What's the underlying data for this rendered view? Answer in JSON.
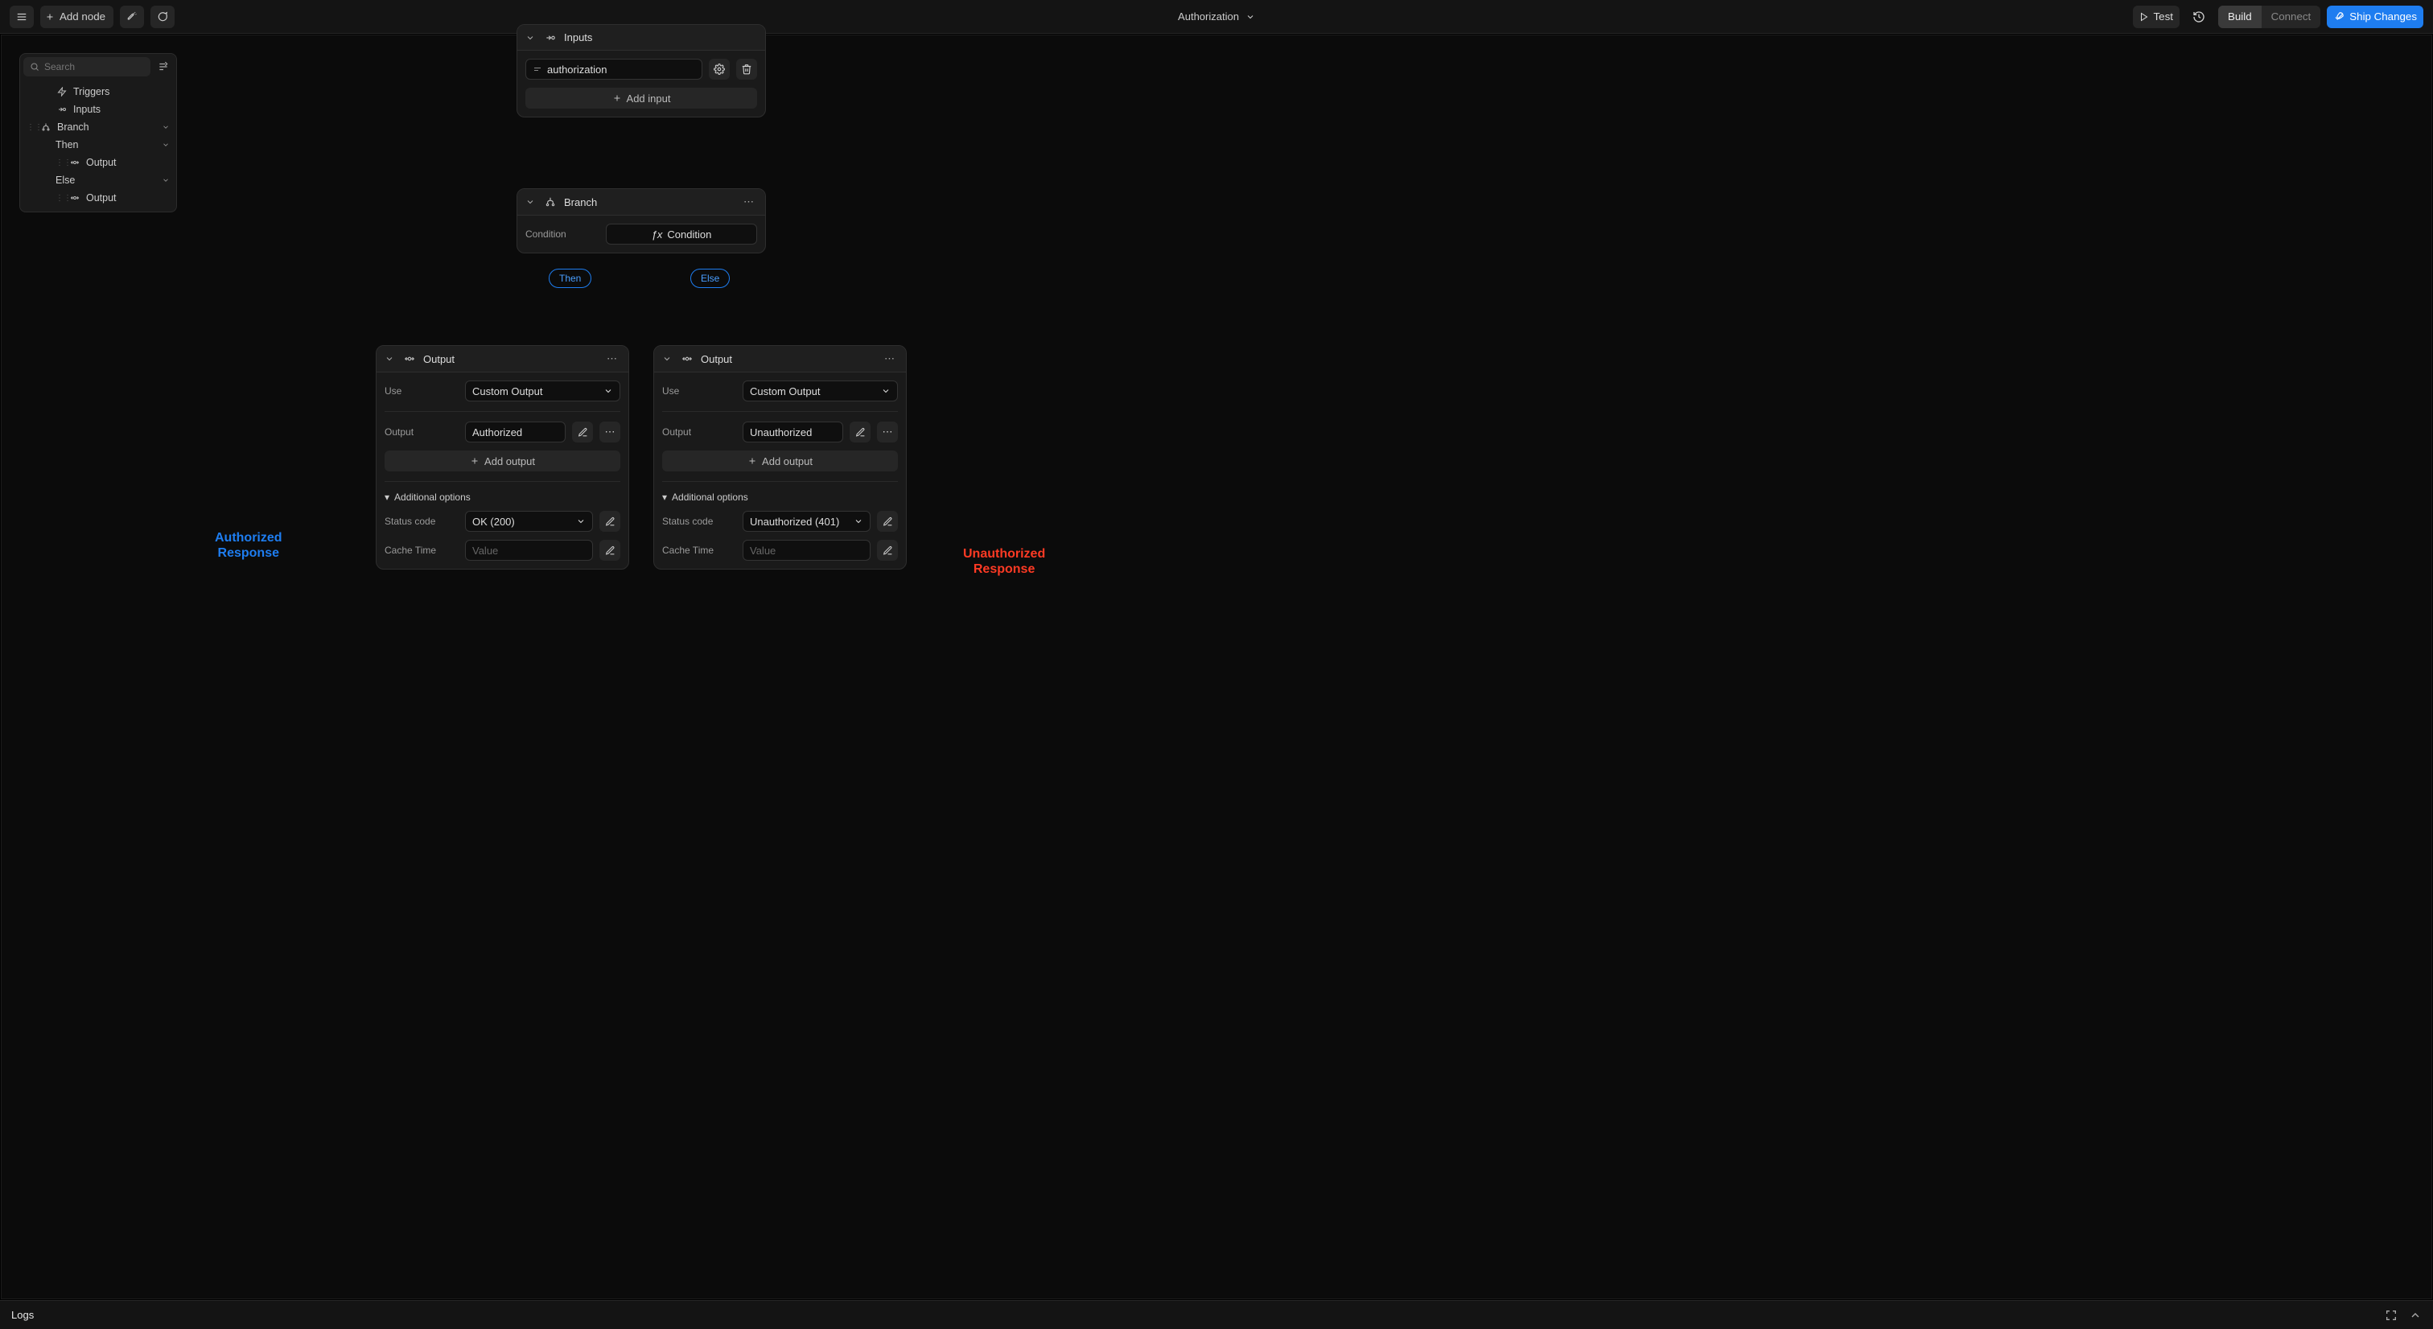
{
  "header": {
    "add_node_label": "Add node",
    "title": "Authorization",
    "test_label": "Test",
    "build_label": "Build",
    "connect_label": "Connect",
    "ship_label": "Ship Changes"
  },
  "sidebar": {
    "search_placeholder": "Search",
    "items": {
      "triggers": "Triggers",
      "inputs": "Inputs",
      "branch": "Branch",
      "then": "Then",
      "output_then": "Output",
      "else": "Else",
      "output_else": "Output"
    }
  },
  "nodes": {
    "inputs": {
      "title": "Inputs",
      "field_value": "authorization",
      "add_label": "Add input"
    },
    "branch": {
      "title": "Branch",
      "condition_label": "Condition",
      "condition_chip": "Condition",
      "then_label": "Then",
      "else_label": "Else"
    },
    "output_a": {
      "title": "Output",
      "use_label": "Use",
      "use_value": "Custom Output",
      "output_label": "Output",
      "output_value": "Authorized",
      "add_output_label": "Add output",
      "additional_label": "Additional options",
      "status_label": "Status code",
      "status_value": "OK (200)",
      "cache_label": "Cache Time",
      "cache_placeholder": "Value"
    },
    "output_b": {
      "title": "Output",
      "use_label": "Use",
      "use_value": "Custom Output",
      "output_label": "Output",
      "output_value": "Unauthorized",
      "add_output_label": "Add output",
      "additional_label": "Additional options",
      "status_label": "Status code",
      "status_value": "Unauthorized (401)",
      "cache_label": "Cache Time",
      "cache_placeholder": "Value"
    }
  },
  "annotations": {
    "authorized_l1": "Authorized",
    "authorized_l2": "Response",
    "unauthorized_l1": "Unauthorized",
    "unauthorized_l2": "Response"
  },
  "footer": {
    "logs_label": "Logs"
  }
}
